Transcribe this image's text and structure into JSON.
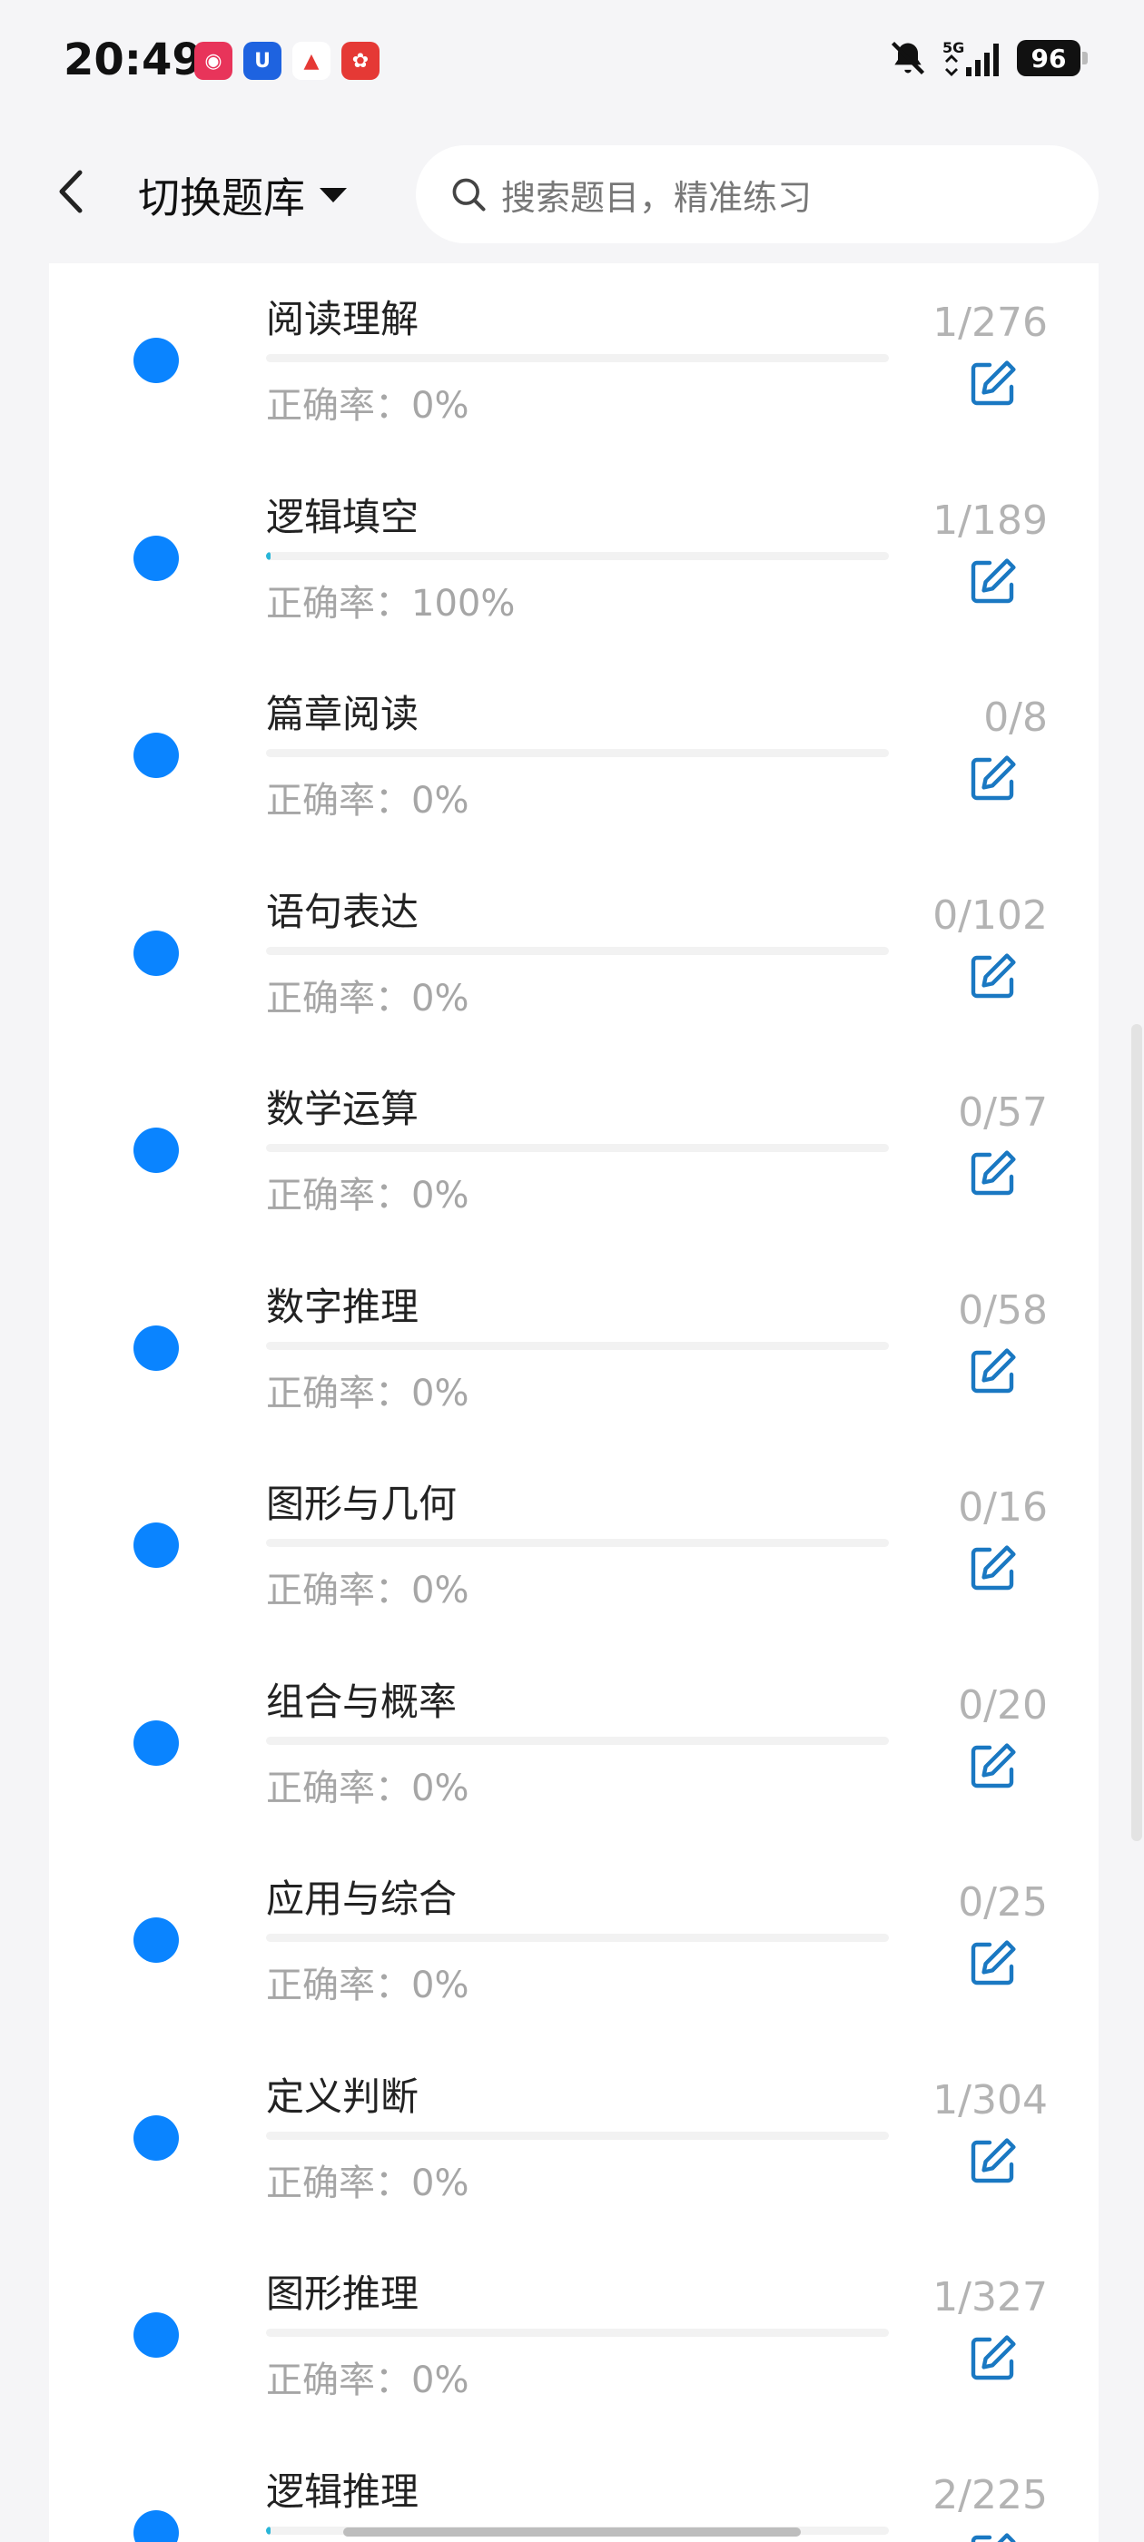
{
  "status": {
    "time": "20:49",
    "battery": "96",
    "network": "5G"
  },
  "header": {
    "title": "切换题库",
    "search_placeholder": "搜索题目，精准练习"
  },
  "rows": [
    {
      "title": "阅读理解",
      "accuracy": "正确率：0%",
      "count": "1/276",
      "progress": 0
    },
    {
      "title": "逻辑填空",
      "accuracy": "正确率：100%",
      "count": "1/189",
      "progress": 0.005
    },
    {
      "title": "篇章阅读",
      "accuracy": "正确率：0%",
      "count": "0/8",
      "progress": 0
    },
    {
      "title": "语句表达",
      "accuracy": "正确率：0%",
      "count": "0/102",
      "progress": 0
    },
    {
      "title": "数学运算",
      "accuracy": "正确率：0%",
      "count": "0/57",
      "progress": 0
    },
    {
      "title": "数字推理",
      "accuracy": "正确率：0%",
      "count": "0/58",
      "progress": 0
    },
    {
      "title": "图形与几何",
      "accuracy": "正确率：0%",
      "count": "0/16",
      "progress": 0
    },
    {
      "title": "组合与概率",
      "accuracy": "正确率：0%",
      "count": "0/20",
      "progress": 0
    },
    {
      "title": "应用与综合",
      "accuracy": "正确率：0%",
      "count": "0/25",
      "progress": 0
    },
    {
      "title": "定义判断",
      "accuracy": "正确率：0%",
      "count": "1/304",
      "progress": 0
    },
    {
      "title": "图形推理",
      "accuracy": "正确率：0%",
      "count": "1/327",
      "progress": 0
    },
    {
      "title": "逻辑推理",
      "accuracy": "",
      "count": "2/225",
      "progress": 0.005
    }
  ],
  "colors": {
    "accent": "#0a84ff",
    "progress": "#29b6d8"
  }
}
